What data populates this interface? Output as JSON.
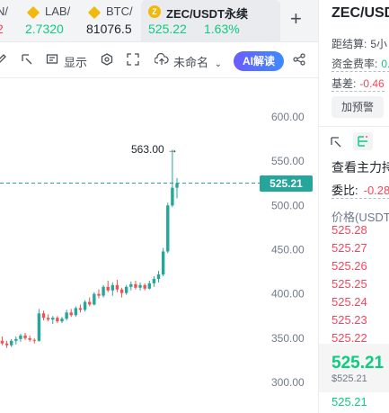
{
  "tabs": [
    {
      "name": "N/",
      "price": "2",
      "price_color": "red"
    },
    {
      "name": "LAB/",
      "price": "2.7320",
      "price_color": "green"
    },
    {
      "name": "BTC/",
      "price": "81076.5",
      "price_color": "dark"
    },
    {
      "name": "ZEC/USDT永续",
      "price": "525.22",
      "change": "1.63%",
      "price_color": "green",
      "active": true
    }
  ],
  "toolbar": {
    "display_label": "显示",
    "unnamed_label": "未命名",
    "ai_label": "AI解读"
  },
  "chart": {
    "peak_label": "563.00",
    "current_price_label": "525.21",
    "y_ticks": [
      "600.00",
      "550.00",
      "500.00",
      "450.00",
      "400.00",
      "350.00",
      "300.00"
    ]
  },
  "chart_data": {
    "type": "candlestick",
    "ylim": [
      290,
      610
    ],
    "y_ticks": [
      600,
      550,
      500,
      450,
      400,
      350,
      300
    ],
    "current_price": 525.21,
    "peak": 563.0,
    "candles": [
      {
        "o": 334,
        "h": 336,
        "l": 331,
        "c": 333
      },
      {
        "o": 333,
        "h": 335,
        "l": 330,
        "c": 334
      },
      {
        "o": 334,
        "h": 336,
        "l": 331,
        "c": 332
      },
      {
        "o": 332,
        "h": 334,
        "l": 328,
        "c": 333
      },
      {
        "o": 333,
        "h": 336,
        "l": 331,
        "c": 335
      },
      {
        "o": 335,
        "h": 337,
        "l": 332,
        "c": 334
      },
      {
        "o": 334,
        "h": 335,
        "l": 324,
        "c": 326
      },
      {
        "o": 326,
        "h": 330,
        "l": 319,
        "c": 321
      },
      {
        "o": 321,
        "h": 325,
        "l": 318,
        "c": 323
      },
      {
        "o": 323,
        "h": 327,
        "l": 320,
        "c": 325
      },
      {
        "o": 325,
        "h": 328,
        "l": 321,
        "c": 323
      },
      {
        "o": 323,
        "h": 330,
        "l": 322,
        "c": 328
      },
      {
        "o": 328,
        "h": 332,
        "l": 325,
        "c": 330
      },
      {
        "o": 330,
        "h": 336,
        "l": 327,
        "c": 334
      },
      {
        "o": 334,
        "h": 338,
        "l": 330,
        "c": 332
      },
      {
        "o": 332,
        "h": 343,
        "l": 331,
        "c": 340
      },
      {
        "o": 340,
        "h": 350,
        "l": 337,
        "c": 347
      },
      {
        "o": 347,
        "h": 352,
        "l": 342,
        "c": 344
      },
      {
        "o": 344,
        "h": 347,
        "l": 339,
        "c": 342
      },
      {
        "o": 342,
        "h": 349,
        "l": 340,
        "c": 347
      },
      {
        "o": 347,
        "h": 352,
        "l": 343,
        "c": 349
      },
      {
        "o": 349,
        "h": 355,
        "l": 346,
        "c": 353
      },
      {
        "o": 353,
        "h": 356,
        "l": 348,
        "c": 350
      },
      {
        "o": 350,
        "h": 353,
        "l": 346,
        "c": 348
      },
      {
        "o": 348,
        "h": 350,
        "l": 344,
        "c": 347
      },
      {
        "o": 347,
        "h": 383,
        "l": 346,
        "c": 378
      },
      {
        "o": 378,
        "h": 381,
        "l": 370,
        "c": 373
      },
      {
        "o": 373,
        "h": 377,
        "l": 369,
        "c": 371
      },
      {
        "o": 371,
        "h": 375,
        "l": 366,
        "c": 373
      },
      {
        "o": 373,
        "h": 375,
        "l": 367,
        "c": 369
      },
      {
        "o": 369,
        "h": 374,
        "l": 367,
        "c": 372
      },
      {
        "o": 372,
        "h": 382,
        "l": 370,
        "c": 379
      },
      {
        "o": 379,
        "h": 383,
        "l": 374,
        "c": 376
      },
      {
        "o": 376,
        "h": 386,
        "l": 374,
        "c": 384
      },
      {
        "o": 384,
        "h": 388,
        "l": 379,
        "c": 382
      },
      {
        "o": 382,
        "h": 393,
        "l": 380,
        "c": 391
      },
      {
        "o": 391,
        "h": 396,
        "l": 386,
        "c": 388
      },
      {
        "o": 388,
        "h": 402,
        "l": 387,
        "c": 400
      },
      {
        "o": 400,
        "h": 405,
        "l": 395,
        "c": 398
      },
      {
        "o": 398,
        "h": 410,
        "l": 396,
        "c": 408
      },
      {
        "o": 408,
        "h": 415,
        "l": 402,
        "c": 404
      },
      {
        "o": 404,
        "h": 413,
        "l": 398,
        "c": 410
      },
      {
        "o": 410,
        "h": 416,
        "l": 402,
        "c": 405
      },
      {
        "o": 405,
        "h": 407,
        "l": 396,
        "c": 401
      },
      {
        "o": 401,
        "h": 410,
        "l": 399,
        "c": 408
      },
      {
        "o": 408,
        "h": 414,
        "l": 404,
        "c": 411
      },
      {
        "o": 411,
        "h": 415,
        "l": 405,
        "c": 407
      },
      {
        "o": 407,
        "h": 413,
        "l": 404,
        "c": 410
      },
      {
        "o": 410,
        "h": 412,
        "l": 404,
        "c": 406
      },
      {
        "o": 406,
        "h": 415,
        "l": 405,
        "c": 412
      },
      {
        "o": 412,
        "h": 420,
        "l": 408,
        "c": 417
      },
      {
        "o": 417,
        "h": 426,
        "l": 413,
        "c": 422
      },
      {
        "o": 422,
        "h": 452,
        "l": 420,
        "c": 448
      },
      {
        "o": 448,
        "h": 503,
        "l": 446,
        "c": 500
      },
      {
        "o": 500,
        "h": 563,
        "l": 498,
        "c": 520
      },
      {
        "o": 520,
        "h": 531,
        "l": 508,
        "c": 525
      }
    ]
  },
  "panel": {
    "title": "ZEC/USDT",
    "settle_label": "距结算:",
    "settle_value": "5小",
    "funding_label": "资金费率:",
    "funding_value": "0.",
    "basis_label": "基差:",
    "basis_value": "-0.46",
    "alert_label": "加预警",
    "compare_label": "查看主力持",
    "ratio_label": "委比:",
    "ratio_value": "-0.28",
    "price_header": "价格(USDT",
    "asks": [
      "525.28",
      "525.27",
      "525.26",
      "525.25",
      "525.24",
      "525.23",
      "525.22"
    ],
    "last_price": "525.21",
    "last_price_sub": "$525.21",
    "bid_first": "525.21"
  },
  "colors": {
    "up": "#26a69a",
    "down": "#ef5350",
    "accent": "#f0b90b",
    "ai_gradient_start": "#6a5cff",
    "ai_gradient_end": "#3e8bff"
  }
}
